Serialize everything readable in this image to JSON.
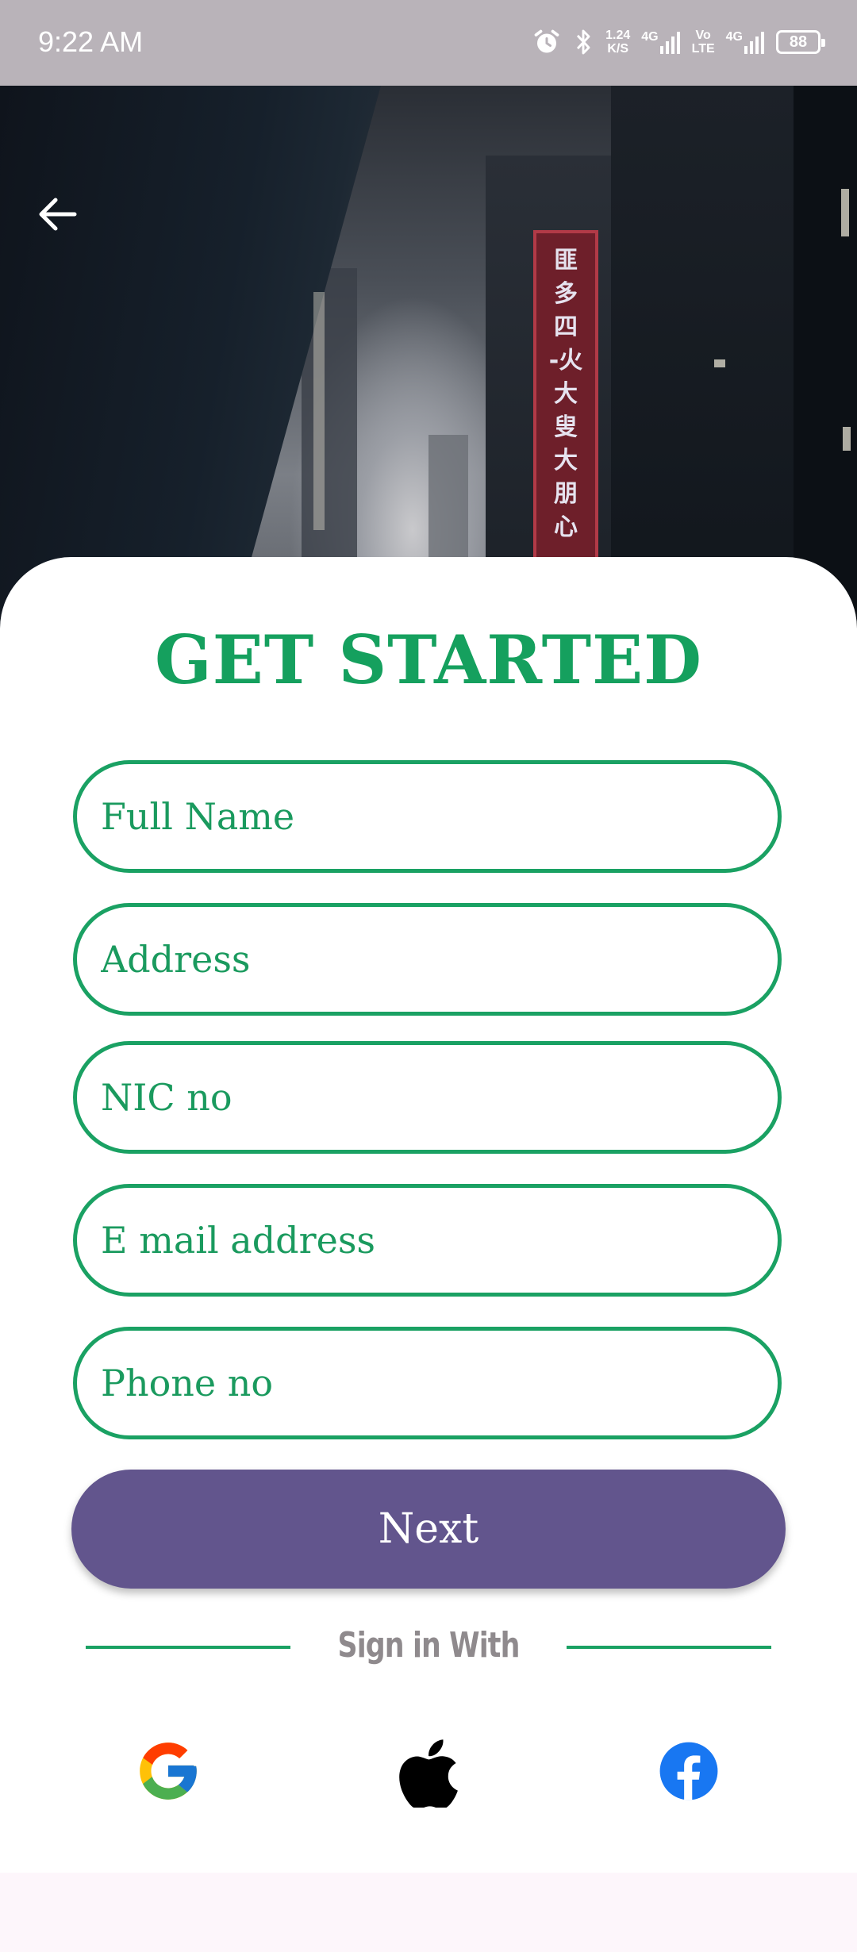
{
  "status_bar": {
    "time": "9:22 AM",
    "net_speed_value": "1.24",
    "net_speed_unit": "K/S",
    "net1": "4G",
    "volte_top": "Vo",
    "volte_bottom": "LTE",
    "net2": "4G",
    "battery": "88"
  },
  "hero": {
    "sign_text": "匪\n多\n四\n-火\n大\n叟\n大\n朋\n心"
  },
  "form": {
    "title": "GET STARTED",
    "fields": [
      {
        "placeholder": "Full Name"
      },
      {
        "placeholder": "Address"
      },
      {
        "placeholder": "NIC no"
      },
      {
        "placeholder": "E mail address"
      },
      {
        "placeholder": "Phone no"
      }
    ],
    "next_label": "Next",
    "sign_in_with": "Sign in With"
  },
  "social": {
    "google": "google-icon",
    "apple": "apple-icon",
    "facebook": "facebook-icon"
  },
  "colors": {
    "accent_green": "#1aa163",
    "button_purple": "#62558d",
    "status_bar": "#b9b3b9"
  }
}
